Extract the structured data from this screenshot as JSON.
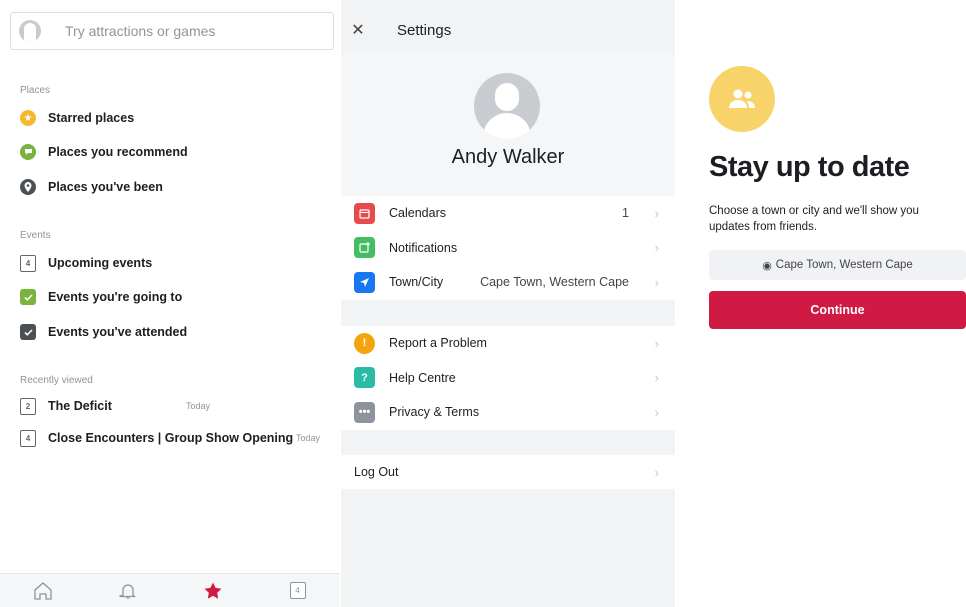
{
  "left": {
    "search": {
      "placeholder": "Try attractions or games"
    },
    "places": {
      "label": "Places",
      "items": [
        {
          "label": "Starred places",
          "icon": "star-icon",
          "color": "#f5b82e"
        },
        {
          "label": "Places you recommend",
          "icon": "speech-bubble-icon",
          "color": "#7bb33f"
        },
        {
          "label": "Places you've been",
          "icon": "map-pin-icon",
          "color": "#4b4f56"
        }
      ]
    },
    "events": {
      "label": "Events",
      "items": [
        {
          "label": "Upcoming events",
          "icon": "calendar-icon",
          "day": "4"
        },
        {
          "label": "Events you're going to",
          "icon": "check-icon",
          "color": "#7bb33f"
        },
        {
          "label": "Events you've attended",
          "icon": "check-icon",
          "color": "#4b4f56"
        }
      ]
    },
    "recent": {
      "label": "Recently viewed",
      "items": [
        {
          "label": "The Deficit",
          "day": "2",
          "time": "Today"
        },
        {
          "label": "Close Encounters | Group Show Opening",
          "day": "4",
          "time": "Today"
        }
      ]
    },
    "nav": {
      "active_color": "#d01a43",
      "calendar_day": "4",
      "items": [
        "home-icon",
        "bell-icon",
        "star-icon",
        "calendar-icon"
      ]
    }
  },
  "middle": {
    "title": "Settings",
    "profile_name": "Andy Walker",
    "group1": [
      {
        "label": "Calendars",
        "value": "1",
        "icon": "calendar-icon",
        "color": "#e54b4b"
      },
      {
        "label": "Notifications",
        "value": "",
        "icon": "notification-icon",
        "color": "#45bd62"
      },
      {
        "label": "Town/City",
        "value": "Cape Town, Western Cape",
        "icon": "location-arrow-icon",
        "color": "#1877f2"
      }
    ],
    "group2": [
      {
        "label": "Report a Problem",
        "icon": "alert-icon",
        "color": "#f2a60c"
      },
      {
        "label": "Help Centre",
        "icon": "question-icon",
        "color": "#2abba7"
      },
      {
        "label": "Privacy & Terms",
        "icon": "more-dots-icon",
        "color": "#8d949e"
      }
    ],
    "logout": "Log Out"
  },
  "right": {
    "badge_color": "#f7d36a",
    "title": "Stay up to date",
    "description": "Choose a town or city and we'll show you updates from friends.",
    "location": "Cape Town, Western Cape",
    "button": "Continue",
    "button_color": "#d01a43"
  }
}
